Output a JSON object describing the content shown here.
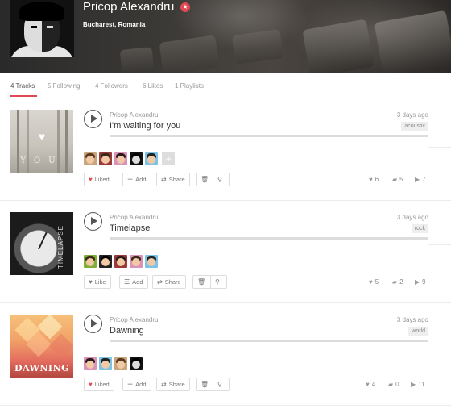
{
  "profile": {
    "name": "Pricop Alexandru",
    "badge": "★",
    "location": "Bucharest, Romania"
  },
  "tabs": [
    {
      "label": "4 Tracks"
    },
    {
      "label": "5 Following"
    },
    {
      "label": "4 Followers"
    },
    {
      "label": "6 Likes"
    },
    {
      "label": "1 Playlists"
    }
  ],
  "tracks": [
    {
      "artist": "Pricop Alexandru",
      "title": "I'm waiting for you",
      "time_ago": "3 days ago",
      "tag": "acoustic",
      "art_text": "YOU",
      "like_label": "Liked",
      "add_label": "Add",
      "share_label": "Share",
      "likes": "6",
      "comments": "5",
      "plays": "7",
      "liker_count": 5
    },
    {
      "artist": "Pricop Alexandru",
      "title": "Timelapse",
      "time_ago": "3 days ago",
      "tag": "rock",
      "art_text": "TIMELAPSE",
      "like_label": "Like",
      "add_label": "Add",
      "share_label": "Share",
      "likes": "5",
      "comments": "2",
      "plays": "9",
      "liker_count": 5
    },
    {
      "artist": "Pricop Alexandru",
      "title": "Dawning",
      "time_ago": "3 days ago",
      "tag": "world",
      "art_text": "DAWNING",
      "like_label": "Liked",
      "add_label": "Add",
      "share_label": "Share",
      "likes": "4",
      "comments": "0",
      "plays": "11",
      "liker_count": 4
    }
  ],
  "icons": {
    "heart": "♥",
    "list": "☰",
    "share": "⇄",
    "trash": "🗑",
    "pin": "⚲",
    "comment": "▰",
    "play": "▶",
    "plus": "+"
  },
  "colors": {
    "accent": "#e04852",
    "muted": "#999999"
  }
}
